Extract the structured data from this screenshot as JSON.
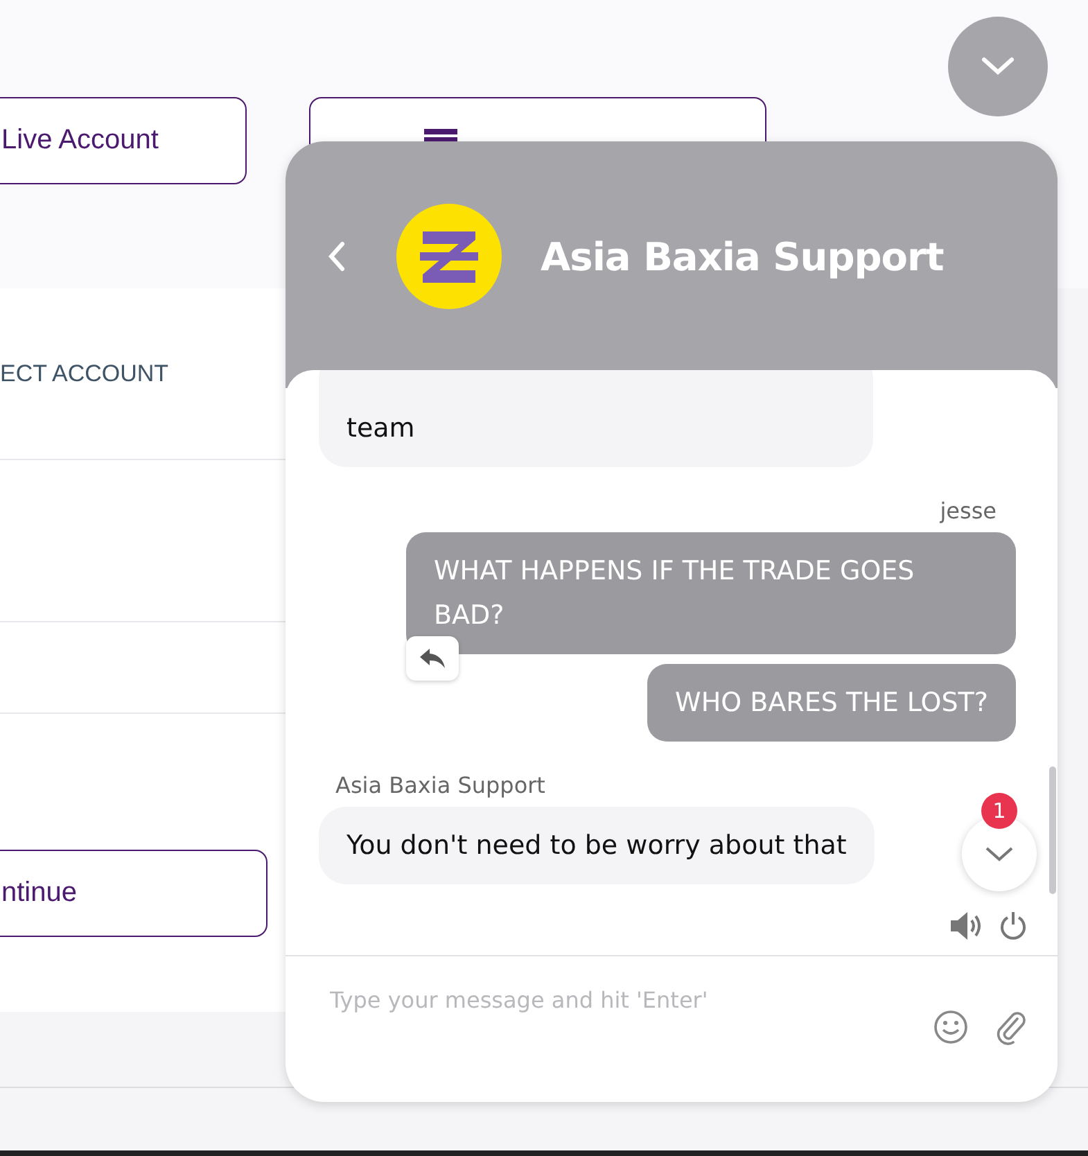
{
  "page": {
    "top_buttons": [
      {
        "label": "Live Account",
        "kind": "plain"
      },
      {
        "kind": "deposit"
      }
    ],
    "account_heading": "ECT ACCOUNT",
    "continue_button": "ntinue"
  },
  "chat": {
    "title": "Asia Baxia Support",
    "groups": [
      {
        "kind": "agent",
        "bubbles": [
          "team"
        ]
      },
      {
        "kind": "own",
        "sender": "jesse",
        "bubbles": [
          "WHAT HAPPENS IF THE TRADE GOES BAD?",
          "WHO BARES THE LOST?"
        ]
      },
      {
        "kind": "agent",
        "sender": "Asia Baxia Support",
        "bubbles": [
          "You don't need to be worry about that"
        ]
      }
    ],
    "unread_count": "1",
    "placeholder": "Type your message and hit 'Enter'"
  }
}
